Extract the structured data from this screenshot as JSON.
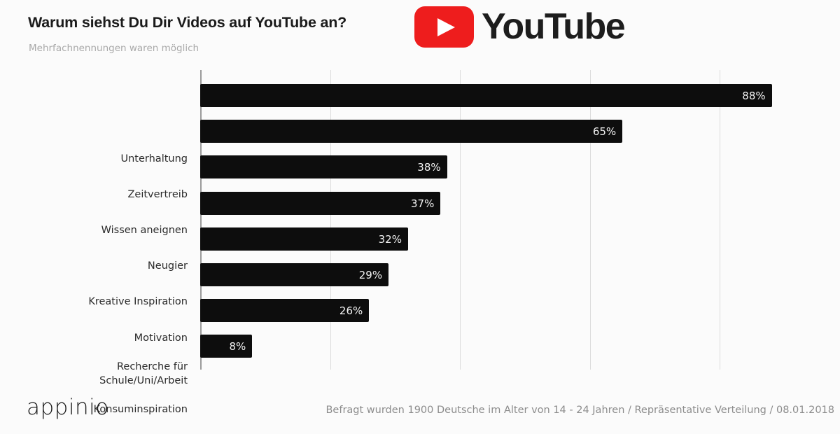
{
  "header": {
    "title": "Warum siehst Du Dir Videos auf YouTube an?",
    "subtitle": "Mehrfachnennungen waren möglich",
    "brand": {
      "name": "YouTube",
      "badge_color": "#EE1D1D",
      "play_icon": "play-triangle"
    }
  },
  "footer": {
    "logo_text": "appinio",
    "source": "Befragt wurden 1900 Deutsche im Alter von 14 - 24 Jahren /  Repräsentative Verteilung / 08.01.2018"
  },
  "colors": {
    "background": "#FBFBFB",
    "bar": "#0D0D0D",
    "grid": "#DCDCDC",
    "axis": "#9B9B9B",
    "value_label": "#F2F2F2",
    "category_label": "#2B2B2B",
    "subtitle": "#A9A9A9",
    "source": "#8C8C8C"
  },
  "chart_data": {
    "type": "bar",
    "orientation": "horizontal",
    "title": "Warum siehst Du Dir Videos auf YouTube an?",
    "subtitle": "Mehrfachnennungen waren möglich",
    "xlabel": "",
    "ylabel": "",
    "xlim": [
      0,
      98
    ],
    "grid": true,
    "gridlines_at": [
      0,
      20,
      40,
      60,
      80
    ],
    "legend": null,
    "unit": "%",
    "categories": [
      "Unterhaltung",
      "Zeitvertreib",
      "Wissen aneignen",
      "Neugier",
      "Kreative Inspiration",
      "Motivation",
      "Recherche für\nSchule/Uni/Arbeit",
      "Konsuminspiration"
    ],
    "values": [
      88,
      65,
      38,
      37,
      32,
      29,
      26,
      8
    ],
    "value_labels": [
      "88%",
      "65%",
      "38%",
      "37%",
      "32%",
      "29%",
      "26%",
      "8%"
    ]
  }
}
